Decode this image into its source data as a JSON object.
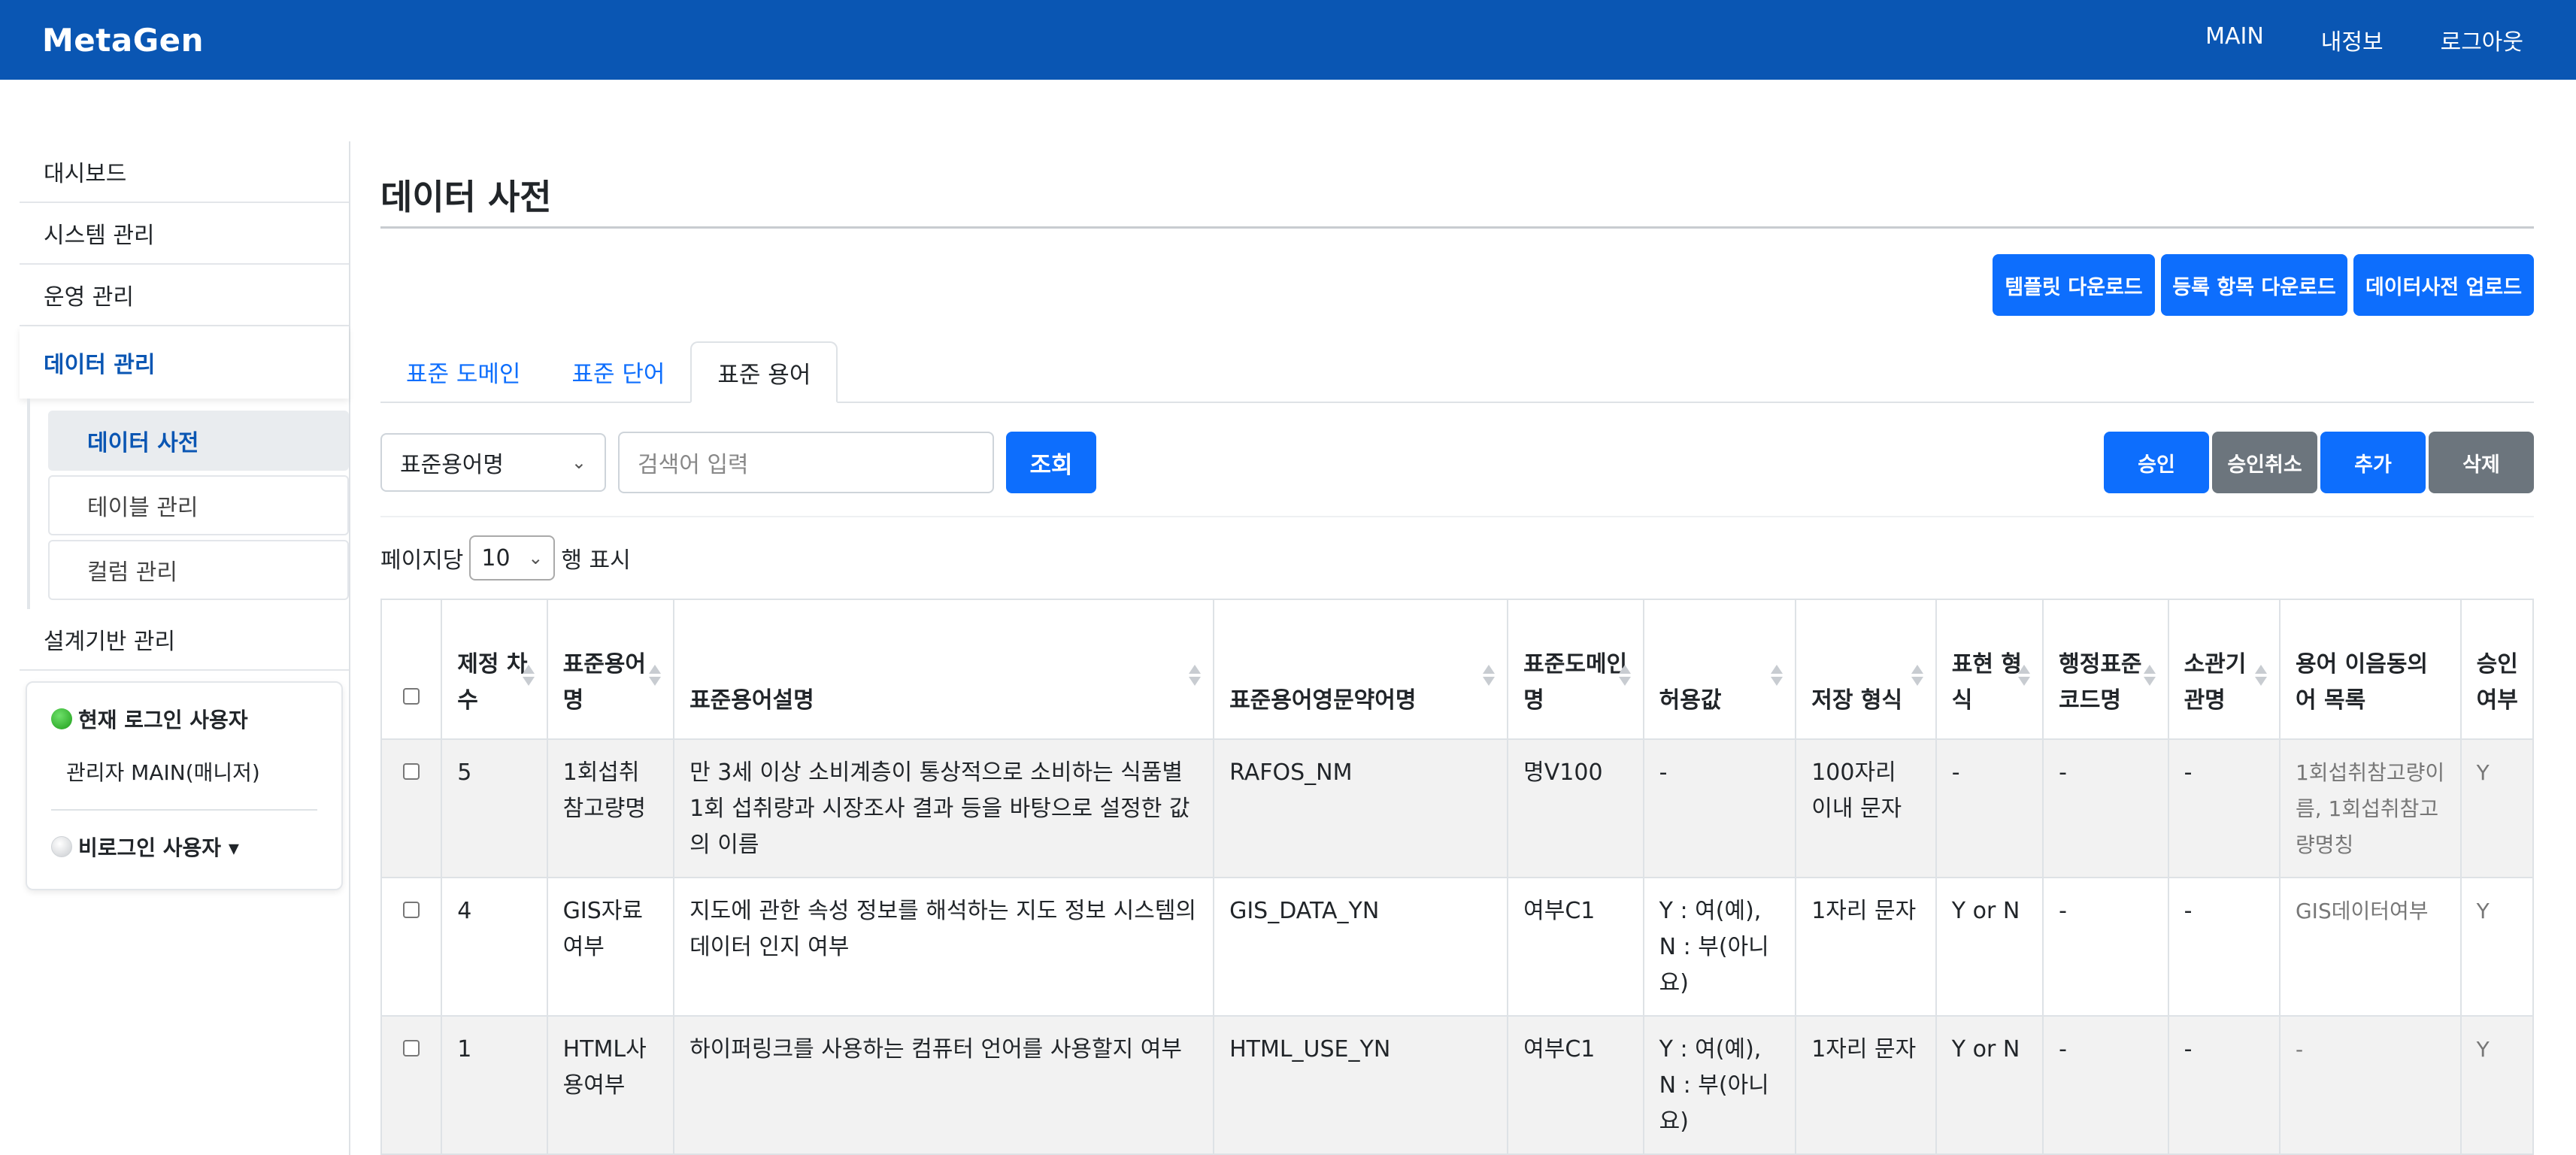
{
  "navbar": {
    "brand": "MetaGen",
    "links": [
      "MAIN",
      "내정보",
      "로그아웃"
    ]
  },
  "sidebar": {
    "items": [
      "대시보드",
      "시스템 관리",
      "운영 관리",
      "데이터 관리"
    ],
    "submenu": [
      "데이터 사전",
      "테이블 관리",
      "컬럼 관리"
    ],
    "after": "설계기반 관리",
    "current_user_label": "현재 로그인 사용자",
    "current_user_name": "관리자 MAIN(매니저)",
    "guest_label": "비로그인 사용자 ▾"
  },
  "main": {
    "title": "데이터 사전",
    "actions": [
      "템플릿 다운로드",
      "등록 항목 다운로드",
      "데이터사전 업로드"
    ],
    "tabs": [
      "표준 도메인",
      "표준 단어",
      "표준 용어"
    ],
    "search": {
      "select_value": "표준용어명",
      "placeholder": "검색어 입력",
      "button": "조회"
    },
    "right_buttons": [
      "승인",
      "승인취소",
      "추가",
      "삭제"
    ],
    "perpage": {
      "prefix": "페이지당",
      "value": "10",
      "suffix": "행 표시"
    }
  },
  "table": {
    "headers": [
      "제정 차수",
      "표준용어명",
      "표준용어설명",
      "표준용어영문약어명",
      "표준도메인명",
      "허용값",
      "저장 형식",
      "표현 형식",
      "행정표준코드명",
      "소관기관명",
      "용어 이음동의어 목록",
      "승인 여부"
    ],
    "rows": [
      [
        "5",
        "1회섭취참고량명",
        "만 3세 이상 소비계층이 통상적으로 소비하는 식품별 1회 섭취량과 시장조사 결과 등을 바탕으로 설정한 값의 이름",
        "RAFOS_NM",
        "명V100",
        "-",
        "100자리 이내 문자",
        "-",
        "-",
        "-",
        "1회섭취참고량이름, 1회섭취참고량명칭",
        "Y"
      ],
      [
        "4",
        "GIS자료여부",
        "지도에 관한 속성 정보를 해석하는 지도 정보 시스템의 데이터 인지 여부",
        "GIS_DATA_YN",
        "여부C1",
        "Y : 여(예), N : 부(아니요)",
        "1자리 문자",
        "Y or N",
        "-",
        "-",
        "GIS데이터여부",
        "Y"
      ],
      [
        "1",
        "HTML사용여부",
        "하이퍼링크를 사용하는 컴퓨터 언어를 사용할지 여부",
        "HTML_USE_YN",
        "여부C1",
        "Y : 여(예), N : 부(아니요)",
        "1자리 문자",
        "Y or N",
        "-",
        "-",
        "-",
        "Y"
      ]
    ]
  },
  "colors": {
    "navbar": "#0a56b3",
    "primary": "#0d6efd",
    "secondary": "#6c757d"
  }
}
